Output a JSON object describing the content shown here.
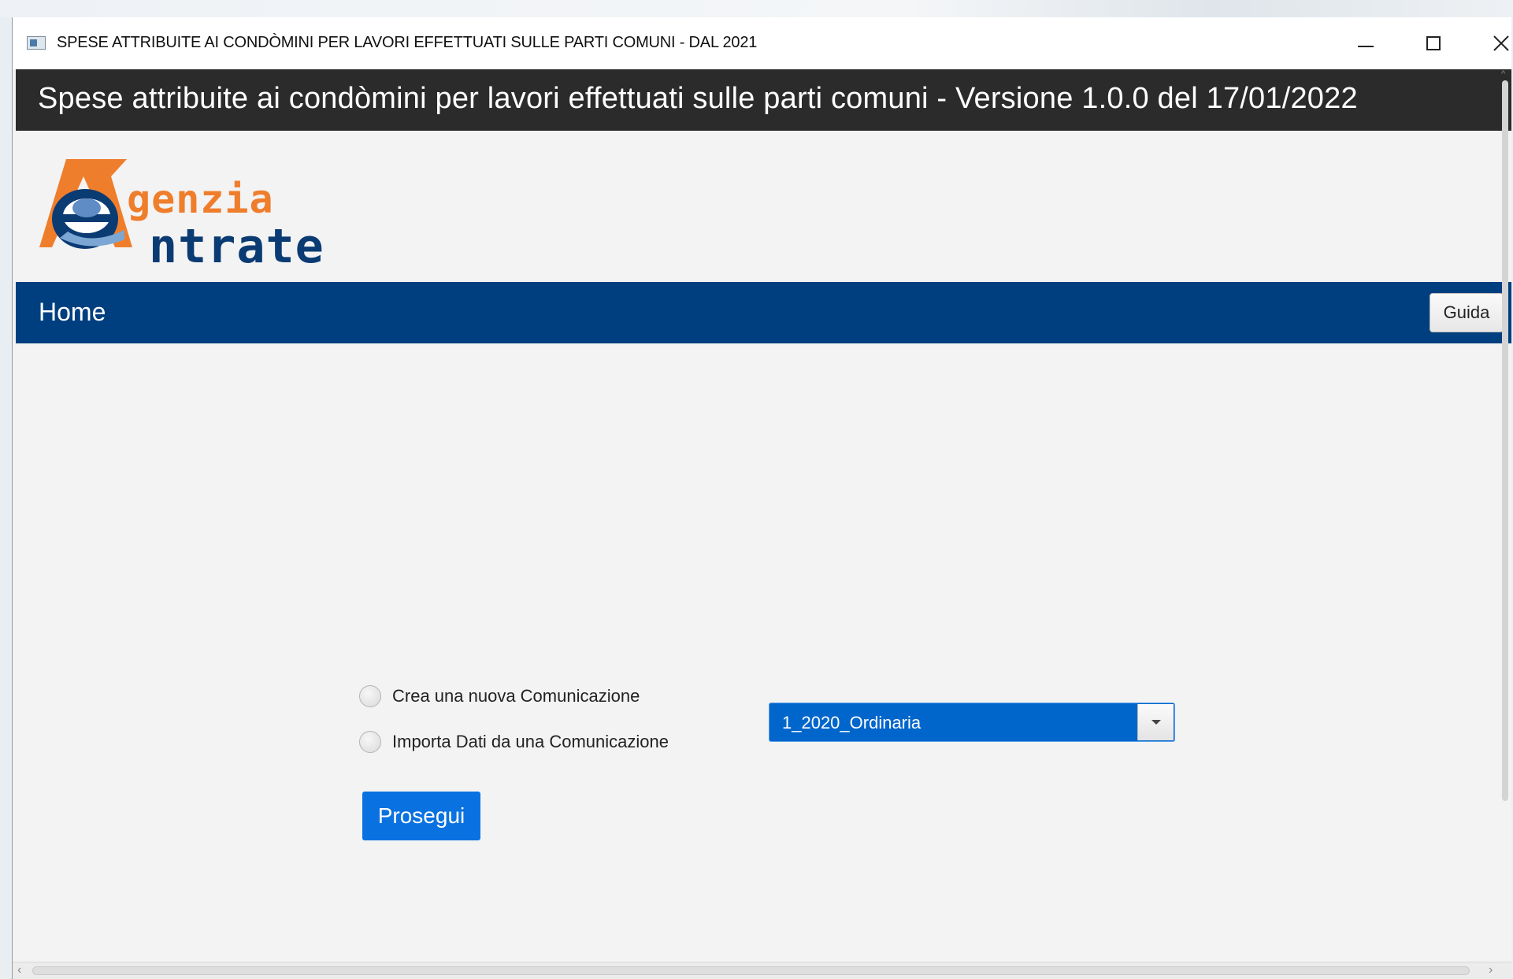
{
  "window": {
    "title": "SPESE ATTRIBUITE AI CONDÒMINI PER LAVORI EFFETTUATI SULLE PARTI COMUNI - DAL 2021",
    "controls": [
      "minimize-icon",
      "maximize-icon",
      "close-icon"
    ]
  },
  "header": {
    "title": "Spese attribuite ai condòmini per lavori effettuati sulle parti comuni - Versione 1.0.0 del 17/01/2022"
  },
  "logo": {
    "line1": "genzia",
    "line2": "ntrate",
    "colors": {
      "orange": "#ef7e2c",
      "blue": "#0b3b73"
    }
  },
  "nav": {
    "home_label": "Home",
    "guide_label": "Guida"
  },
  "form": {
    "option_new": "Crea una nuova Comunicazione",
    "option_import": "Importa Dati da una Comunicazione",
    "import_selected": "1_2020_Ordinaria",
    "proceed_label": "Prosegui"
  },
  "colors": {
    "header_bg": "#2b2b2b",
    "nav_bg": "#003f7f",
    "accent": "#0a72e0",
    "combo_bg": "#0066cc"
  }
}
